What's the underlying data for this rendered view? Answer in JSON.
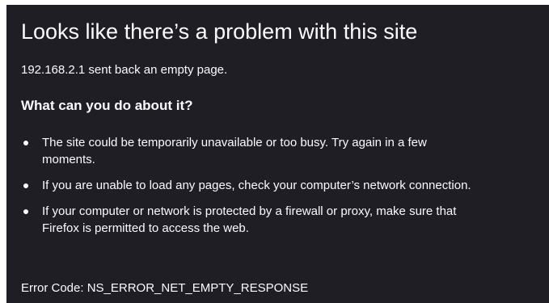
{
  "page": {
    "background_color": "#ffffff",
    "panel_color": "#1f1e25",
    "text_color": "#fbfbfe"
  },
  "error": {
    "title": "Looks like there’s a problem with this site",
    "short_description": "192.168.2.1 sent back an empty page.",
    "what_can_you_do": "What can you do about it?",
    "suggestions": [
      {
        "line1": "The site could be temporarily unavailable or too busy. Try again in a few",
        "line2": "moments."
      },
      {
        "line1": "If you are unable to load any pages, check your computer’s network connection."
      },
      {
        "line1": "If your computer or network is protected by a firewall or proxy, make sure that",
        "line2": "Firefox is permitted to access the web."
      }
    ],
    "error_code": "Error Code: NS_ERROR_NET_EMPTY_RESPONSE"
  }
}
